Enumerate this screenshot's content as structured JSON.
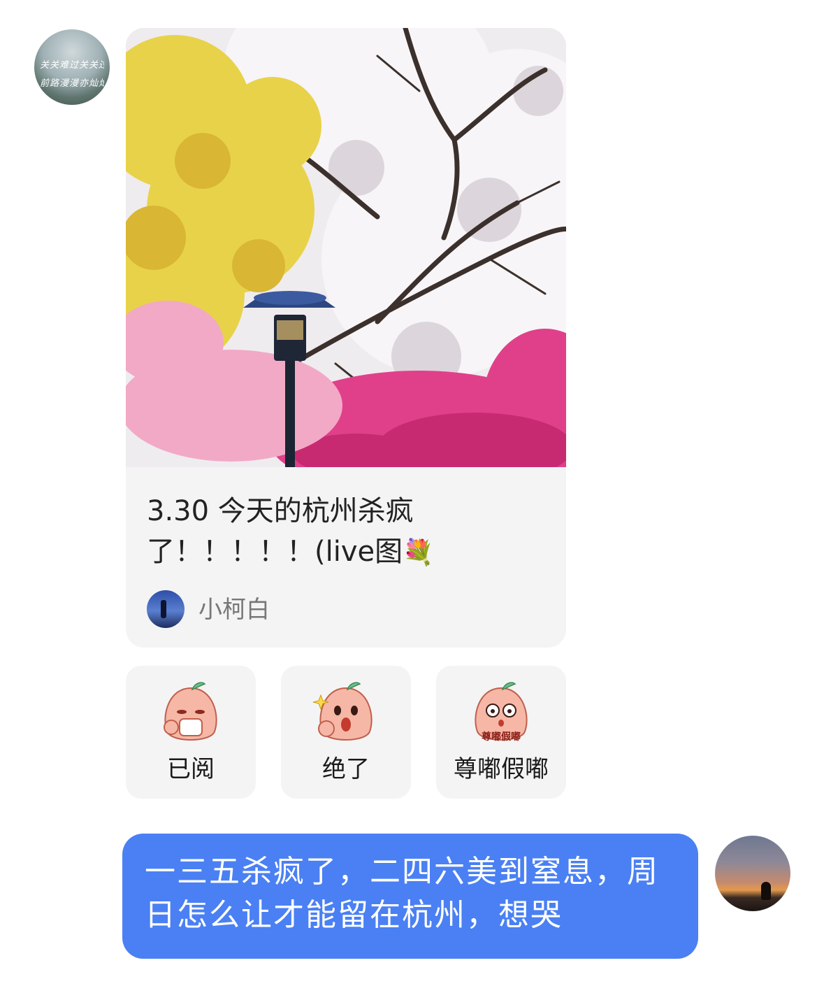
{
  "incoming": {
    "sender_avatar": {
      "line1": "关关难过关关过",
      "line2": "前路漫漫亦灿灿"
    },
    "shared_post": {
      "title_text": "3.30 今天的杭州杀疯了！！！！！(live图",
      "title_emoji": "💐",
      "author_name": "小柯白"
    },
    "quick_stickers": [
      {
        "label": "已阅",
        "face": "peach-sipping-tea-icon"
      },
      {
        "label": "绝了",
        "face": "peach-thumbs-up-icon"
      },
      {
        "label": "尊嘟假嘟",
        "face": "peach-surprised-icon",
        "caption": "尊嘟假嘟"
      }
    ]
  },
  "outgoing": {
    "message": "一三五杀疯了，二四六美到窒息，周日怎么让才能留在杭州，想哭"
  },
  "colors": {
    "bubble_blue": "#4a80f3",
    "card_gray": "#f4f4f5",
    "sticker_peach": "#f6b7a6"
  }
}
